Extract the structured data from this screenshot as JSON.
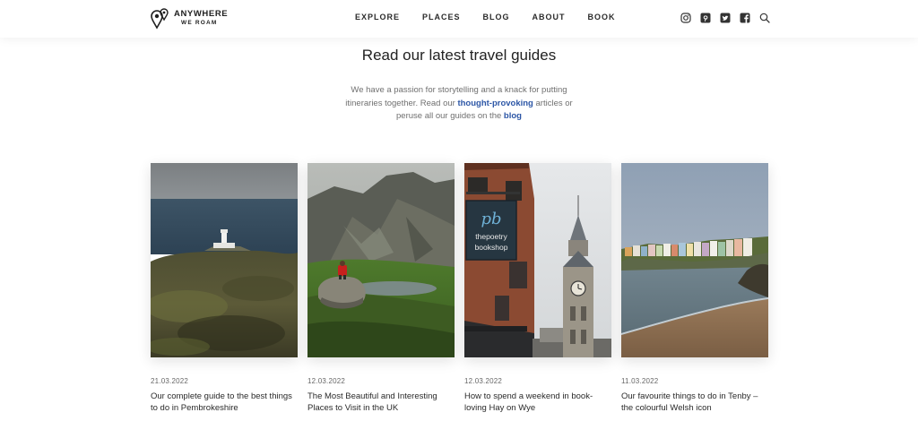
{
  "brand": {
    "name_line1": "ANYWHERE",
    "name_line2": "WE ROAM",
    "logo_icon": "map-pin-pair-icon"
  },
  "nav": {
    "items": [
      {
        "label": "EXPLORE"
      },
      {
        "label": "PLACES"
      },
      {
        "label": "BLOG"
      },
      {
        "label": "ABOUT"
      },
      {
        "label": "BOOK"
      }
    ]
  },
  "social": {
    "icons": [
      "instagram-icon",
      "pinterest-icon",
      "twitter-icon",
      "facebook-icon",
      "search-icon"
    ]
  },
  "intro": {
    "title": "Read our latest travel guides",
    "text_part1": "We have a passion for storytelling and a knack for putting itineraries together. Read our ",
    "link1": "thought-provoking",
    "text_part2": " articles or peruse all our guides on the ",
    "link2": "blog"
  },
  "cards": [
    {
      "date": "21.03.2022",
      "title": "Our complete guide to the best things to do in Pembrokeshire",
      "image": "lighthouse-coast-photo"
    },
    {
      "date": "12.03.2022",
      "title": "The Most Beautiful and Interesting Places to Visit in the UK",
      "image": "mountain-valley-photo"
    },
    {
      "date": "12.03.2022",
      "title": "How to spend a weekend in book-loving Hay on Wye",
      "image": "bookshop-clocktower-photo",
      "sign_line1": "pb",
      "sign_line2": "thepoetry",
      "sign_line3": "bookshop"
    },
    {
      "date": "11.03.2022",
      "title": "Our favourite things to do in Tenby – the colourful Welsh icon",
      "image": "tenby-beach-photo"
    }
  ],
  "colors": {
    "accent_link": "#2c56a6",
    "text_dark": "#222222",
    "text_muted": "#707070"
  }
}
